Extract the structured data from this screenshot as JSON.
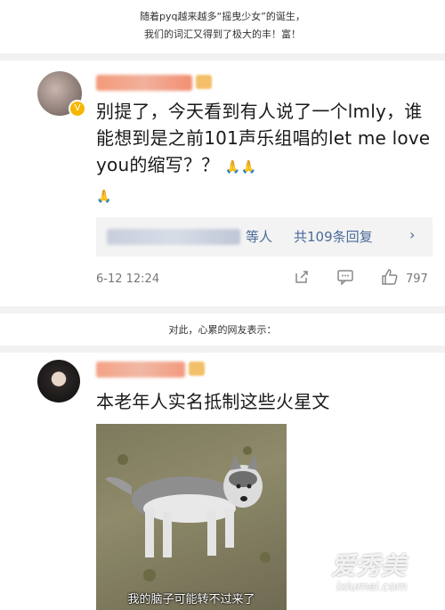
{
  "top_caption": {
    "line1": "随着pyq越来越多“摇曳少女”的诞生，",
    "line2": "我们的词汇又得到了极大的丰！富！"
  },
  "comment1": {
    "text": "别提了，今天看到有人说了一个lmly，谁能想到是之前101声乐组唱的let me love you的缩写？？",
    "reply_summary_suffix": "等人",
    "reply_count_label": "共109条回复",
    "time": "6-12 12:24",
    "like_count": "797"
  },
  "middle_caption": "对此，心累的网友表示：",
  "comment2": {
    "text": "本老年人实名抵制这些火星文",
    "meme_caption": "我的脑子可能转不过来了"
  },
  "watermark": {
    "chinese": "爱秀美",
    "url": "ixiumei.com"
  },
  "colors": {
    "link": "#4a6a9a",
    "divider": "#f2f2f2"
  }
}
